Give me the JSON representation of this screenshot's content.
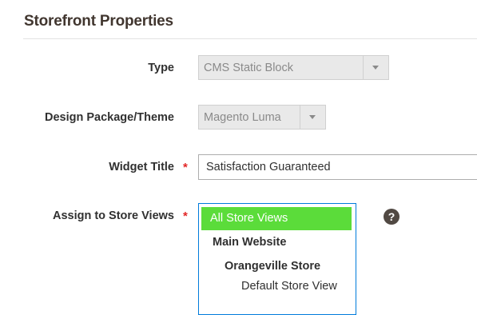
{
  "section": {
    "title": "Storefront Properties"
  },
  "fields": {
    "type": {
      "label": "Type",
      "value": "CMS Static Block"
    },
    "theme": {
      "label": "Design Package/Theme",
      "value": "Magento Luma"
    },
    "widget_title": {
      "label": "Widget Title",
      "required_mark": "*",
      "value": "Satisfaction Guaranteed"
    },
    "store_views": {
      "label": "Assign to Store Views",
      "required_mark": "*",
      "options": [
        "All Store Views",
        "Main Website",
        "Orangeville Store",
        "Default Store View"
      ],
      "selected": "All Store Views"
    }
  },
  "help": {
    "icon": "question-circle-icon",
    "glyph": "?"
  },
  "colors": {
    "selected_option_bg": "#5bdc3a",
    "focus_border": "#007bdb",
    "required": "#e22626"
  }
}
